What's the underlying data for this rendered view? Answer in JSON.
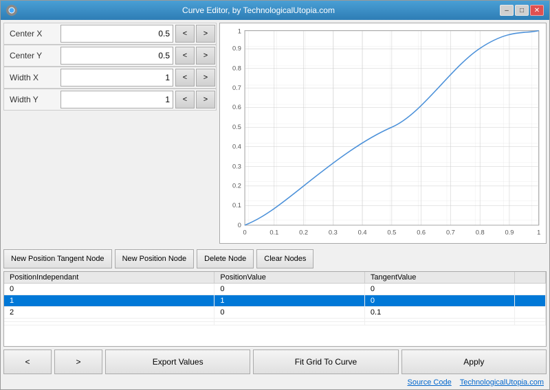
{
  "window": {
    "title": "Curve Editor, by TechnologicalUtopia.com",
    "min_btn": "–",
    "max_btn": "□",
    "close_btn": "✕"
  },
  "params": [
    {
      "label": "Center X",
      "value": "0.5",
      "dec_btn": "<",
      "inc_btn": ">"
    },
    {
      "label": "Center Y",
      "value": "0.5",
      "dec_btn": "<",
      "inc_btn": ">"
    },
    {
      "label": "Width X",
      "value": "1",
      "dec_btn": "<",
      "inc_btn": ">"
    },
    {
      "label": "Width Y",
      "value": "1",
      "dec_btn": "<",
      "inc_btn": ">"
    }
  ],
  "node_buttons": [
    "New Position Tangent Node",
    "New Position Node",
    "Delete Node",
    "Clear Nodes"
  ],
  "table": {
    "headers": [
      "PositionIndependant",
      "PositionValue",
      "TangentValue"
    ],
    "rows": [
      {
        "pos_ind": "0",
        "pos_val": "0",
        "tan_val": "0",
        "selected": false
      },
      {
        "pos_ind": "1",
        "pos_val": "1",
        "tan_val": "0",
        "selected": true
      },
      {
        "pos_ind": "2",
        "pos_val": "0",
        "tan_val": "0.1",
        "selected": false
      }
    ]
  },
  "toolbar": {
    "prev_btn": "<",
    "next_btn": ">",
    "export_btn": "Export Values",
    "fit_btn": "Fit Grid To Curve",
    "apply_btn": "Apply"
  },
  "footer": {
    "source_code": "Source Code",
    "website": "TechnologicalUtopia.com"
  },
  "chart": {
    "x_labels": [
      "0",
      "0.1",
      "0.2",
      "0.3",
      "0.4",
      "0.5",
      "0.6",
      "0.7",
      "0.8",
      "0.9",
      "1"
    ],
    "y_labels": [
      "0",
      "0.1",
      "0.2",
      "0.3",
      "0.4",
      "0.5",
      "0.6",
      "0.7",
      "0.8",
      "0.9",
      "1"
    ]
  }
}
